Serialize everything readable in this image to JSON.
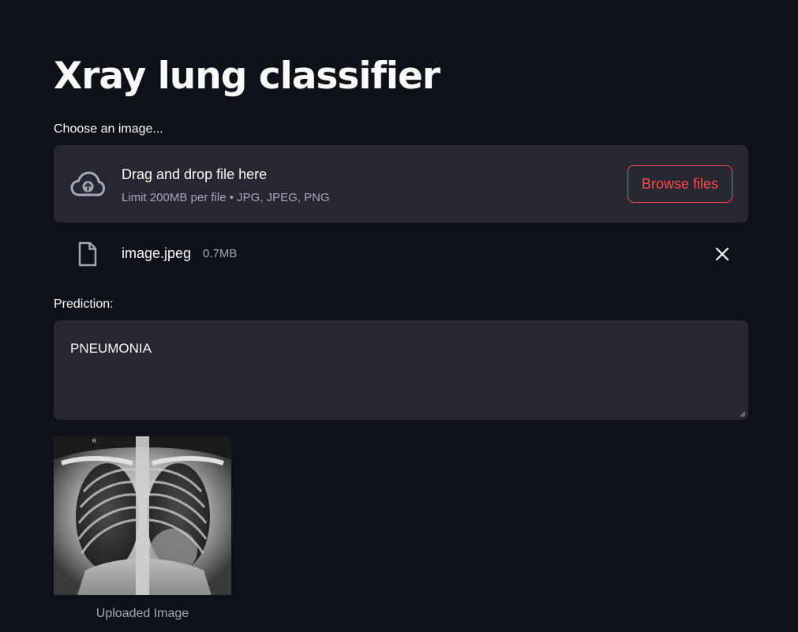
{
  "page": {
    "title": "Xray lung classifier"
  },
  "uploader": {
    "label": "Choose an image...",
    "drop_text": "Drag and drop file here",
    "limit_text": "Limit 200MB per file • JPG, JPEG, PNG",
    "browse_label": "Browse files",
    "icon": "cloud-upload-icon"
  },
  "uploaded_file": {
    "name": "image.jpeg",
    "size": "0.7MB",
    "icon": "file-icon",
    "remove_icon": "close-icon"
  },
  "prediction": {
    "label": "Prediction:",
    "value": "PNEUMONIA"
  },
  "image": {
    "caption": "Uploaded Image",
    "marker": "R"
  },
  "colors": {
    "background": "#0e1117",
    "surface": "#262730",
    "accent": "#ff4b4b",
    "text": "#fafafa",
    "muted": "#a3a8b8"
  }
}
